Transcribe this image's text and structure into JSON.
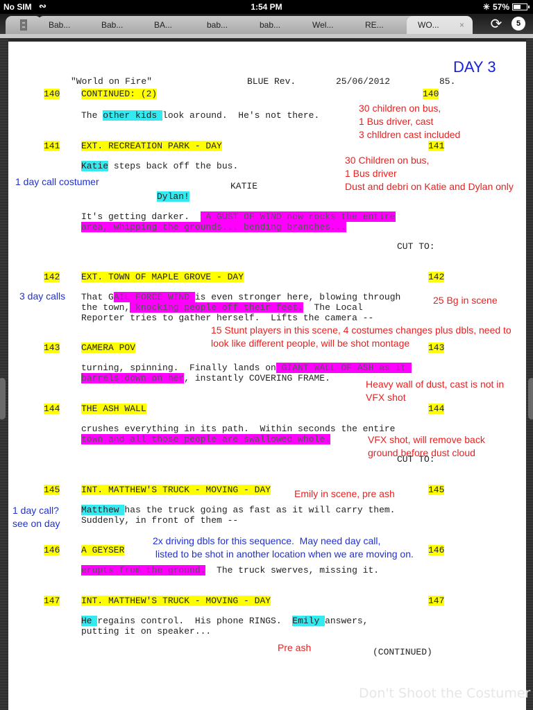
{
  "status_bar": {
    "carrier": "No SIM",
    "time": "1:54 PM",
    "battery_label": "57%",
    "battery_level": 0.57
  },
  "tabs": [
    {
      "label": "Bab...",
      "active": false
    },
    {
      "label": "Bab...",
      "active": false
    },
    {
      "label": "BA...",
      "active": false
    },
    {
      "label": "bab...",
      "active": false
    },
    {
      "label": "bab...",
      "active": false
    },
    {
      "label": "Wel...",
      "active": false
    },
    {
      "label": "RE...",
      "active": false
    },
    {
      "label": "WO...",
      "active": true
    }
  ],
  "toolbar": {
    "gear_badge": "5",
    "close_glyph": "×"
  },
  "document": {
    "day_label": "DAY 3",
    "header": {
      "title": "\"World on Fire\"",
      "revision": "BLUE Rev.",
      "date": "25/06/2012",
      "page": "85."
    },
    "scenes": [
      {
        "number": "140",
        "heading": "CONTINUED: (2)"
      },
      {
        "number": "141",
        "heading": "EXT. RECREATION PARK - DAY"
      },
      {
        "number": "142",
        "heading": "EXT. TOWN OF MAPLE GROVE - DAY"
      },
      {
        "number": "143",
        "heading": "CAMERA POV"
      },
      {
        "number": "144",
        "heading": "THE ASH WALL"
      },
      {
        "number": "145",
        "heading": "INT. MATTHEW'S TRUCK - MOVING - DAY"
      },
      {
        "number": "146",
        "heading": "A GEYSER"
      },
      {
        "number": "147",
        "heading": "INT. MATTHEW'S TRUCK - MOVING - DAY"
      }
    ],
    "lines": {
      "s140_a": "The ",
      "s140_b": "other kids ",
      "s140_c": "look around.  He's not there.",
      "s141_a": "Katie",
      "s141_b": " steps back off the bus.",
      "s141_char": "KATIE",
      "s141_dialog": "Dylan!",
      "s141_c": "It's getting darker.  ",
      "s141_d": " A GUST OF WIND now rocks the entire",
      "s141_e": "area, whipping the grounds... bending branches...",
      "cut_to_1": "CUT TO:",
      "s142_a": "That G",
      "s142_b": "AIL FORCE WIND ",
      "s142_c": "is even stronger here, blowing through",
      "s142_d": "the town,",
      "s142_e": " knocking people off their feet.",
      "s142_f": "  The Local",
      "s142_g": "Reporter tries to gather herself.  Lifts the camera --",
      "s143_a": "turning, spinning.  Finally lands on",
      "s143_b": " GIANT WALL OF ASH as it ",
      "s143_c": "barrels down on her",
      "s143_d": ", instantly COVERING FRAME.",
      "s144_a": "crushes everything in its path.  Within seconds the entire",
      "s144_b": "town and all those people are swallowed whole.",
      "cut_to_2": "CUT TO:",
      "s145_a": "Matthew ",
      "s145_b": "has the truck going as fast as it will carry them.",
      "s145_c": "Suddenly, in front of them --",
      "s146_a": "erupts from the ground.",
      "s146_b": "  The truck swerves, missing it.",
      "s147_a": "He ",
      "s147_b": "regains control.  His phone RINGS.  ",
      "s147_c": "Emily ",
      "s147_d": "answers,",
      "s147_e": "putting it on speaker...",
      "continued": "(CONTINUED)"
    },
    "notes": {
      "n140": "30 children on bus,\n1 Bus driver, cast\n3 chlldren cast included",
      "n141": "30 Children on bus,\n1 Bus driver\nDust and debri on Katie and Dylan only",
      "n141_left": "1 day call costumer",
      "n142_left": "3 day calls",
      "n142": "25 Bg in scene",
      "n142_stunt": "15 Stunt players in this scene, 4 costumes changes plus dbls, need to\nlook like different people, will be shot montage",
      "n143": "Heavy wall of dust, cast is not in\nVFX shot",
      "n144": "VFX shot, will remove back\nground before dust cloud",
      "n145": "Emily in scene, pre ash",
      "n145_left": "1 day call?\nsee on day",
      "n146": "2x driving dbls for this sequence.  May need day call,\n listed to be shot in another location when we are moving on.",
      "n147": "Pre ash"
    },
    "watermark": "Don't Shoot the Costumer"
  }
}
